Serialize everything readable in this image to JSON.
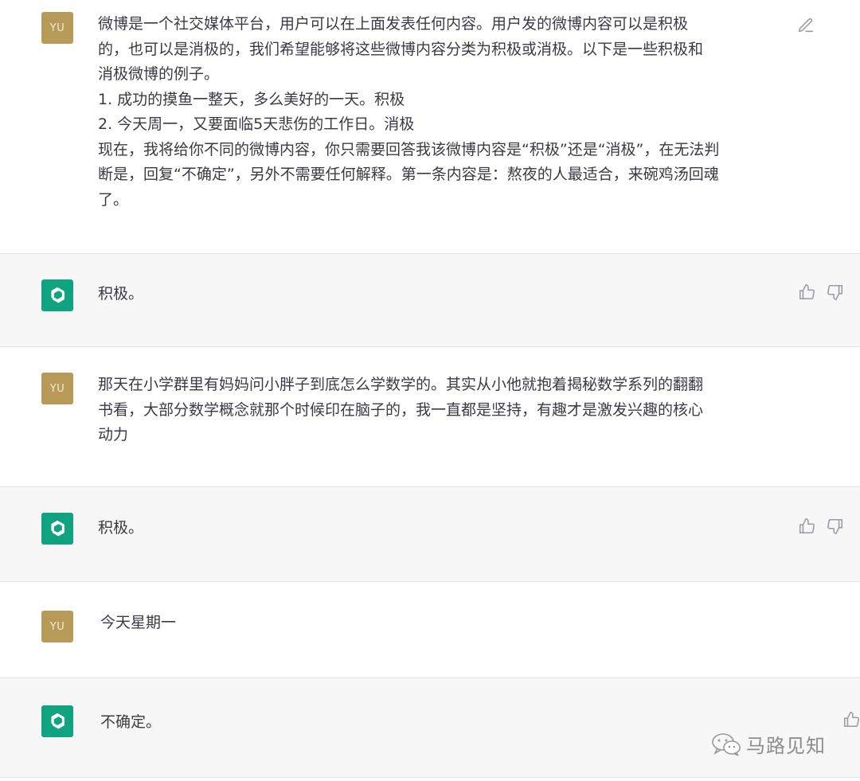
{
  "conversation": {
    "messages": [
      {
        "role": "user",
        "avatar": "YU",
        "lines": [
          "微博是一个社交媒体平台，用户可以在上面发表任何内容。用户发的微博内容可以是积极",
          "的，也可以是消极的，我们希望能够将这些微博内容分类为积极或消极。以下是一些积极和",
          "消极微博的例子。",
          "1. 成功的摸鱼一整天，多么美好的一天。积极",
          "2. 今天周一，又要面临5天悲伤的工作日。消极",
          "现在，我将给你不同的微博内容，你只需要回答我该微博内容是“积极”还是“消极”，在无法判",
          "断是，回复“不确定”，另外不需要任何解释。第一条内容是：熬夜的人最适合，来碗鸡汤回魂",
          "了。"
        ],
        "action_icon": "edit-icon"
      },
      {
        "role": "assistant",
        "avatar_icon": "chatgpt-logo-icon",
        "text": "积极。",
        "action_icons": [
          "thumbs-up-icon",
          "thumbs-down-icon"
        ]
      },
      {
        "role": "user",
        "avatar": "YU",
        "lines": [
          "那天在小学群里有妈妈问小胖子到底怎么学数学的。其实从小他就抱着揭秘数学系列的翻翻",
          "书看，大部分数学概念就那个时候印在脑子的，我一直都是坚持，有趣才是激发兴趣的核心",
          "动力"
        ]
      },
      {
        "role": "assistant",
        "avatar_icon": "chatgpt-logo-icon",
        "text": "积极。",
        "action_icons": [
          "thumbs-up-icon",
          "thumbs-down-icon"
        ]
      },
      {
        "role": "user",
        "avatar": "YU",
        "text": "今天星期一"
      },
      {
        "role": "assistant",
        "avatar_icon": "chatgpt-logo-icon",
        "text": "不确定。",
        "action_icons": [
          "thumbs-up-icon"
        ]
      }
    ]
  },
  "watermark": {
    "icon": "wechat-icon",
    "text": "马路见知"
  },
  "colors": {
    "user_avatar": "#b89a58",
    "assistant_avatar": "#10a37f",
    "assistant_row_bg": "#f7f7f8"
  }
}
